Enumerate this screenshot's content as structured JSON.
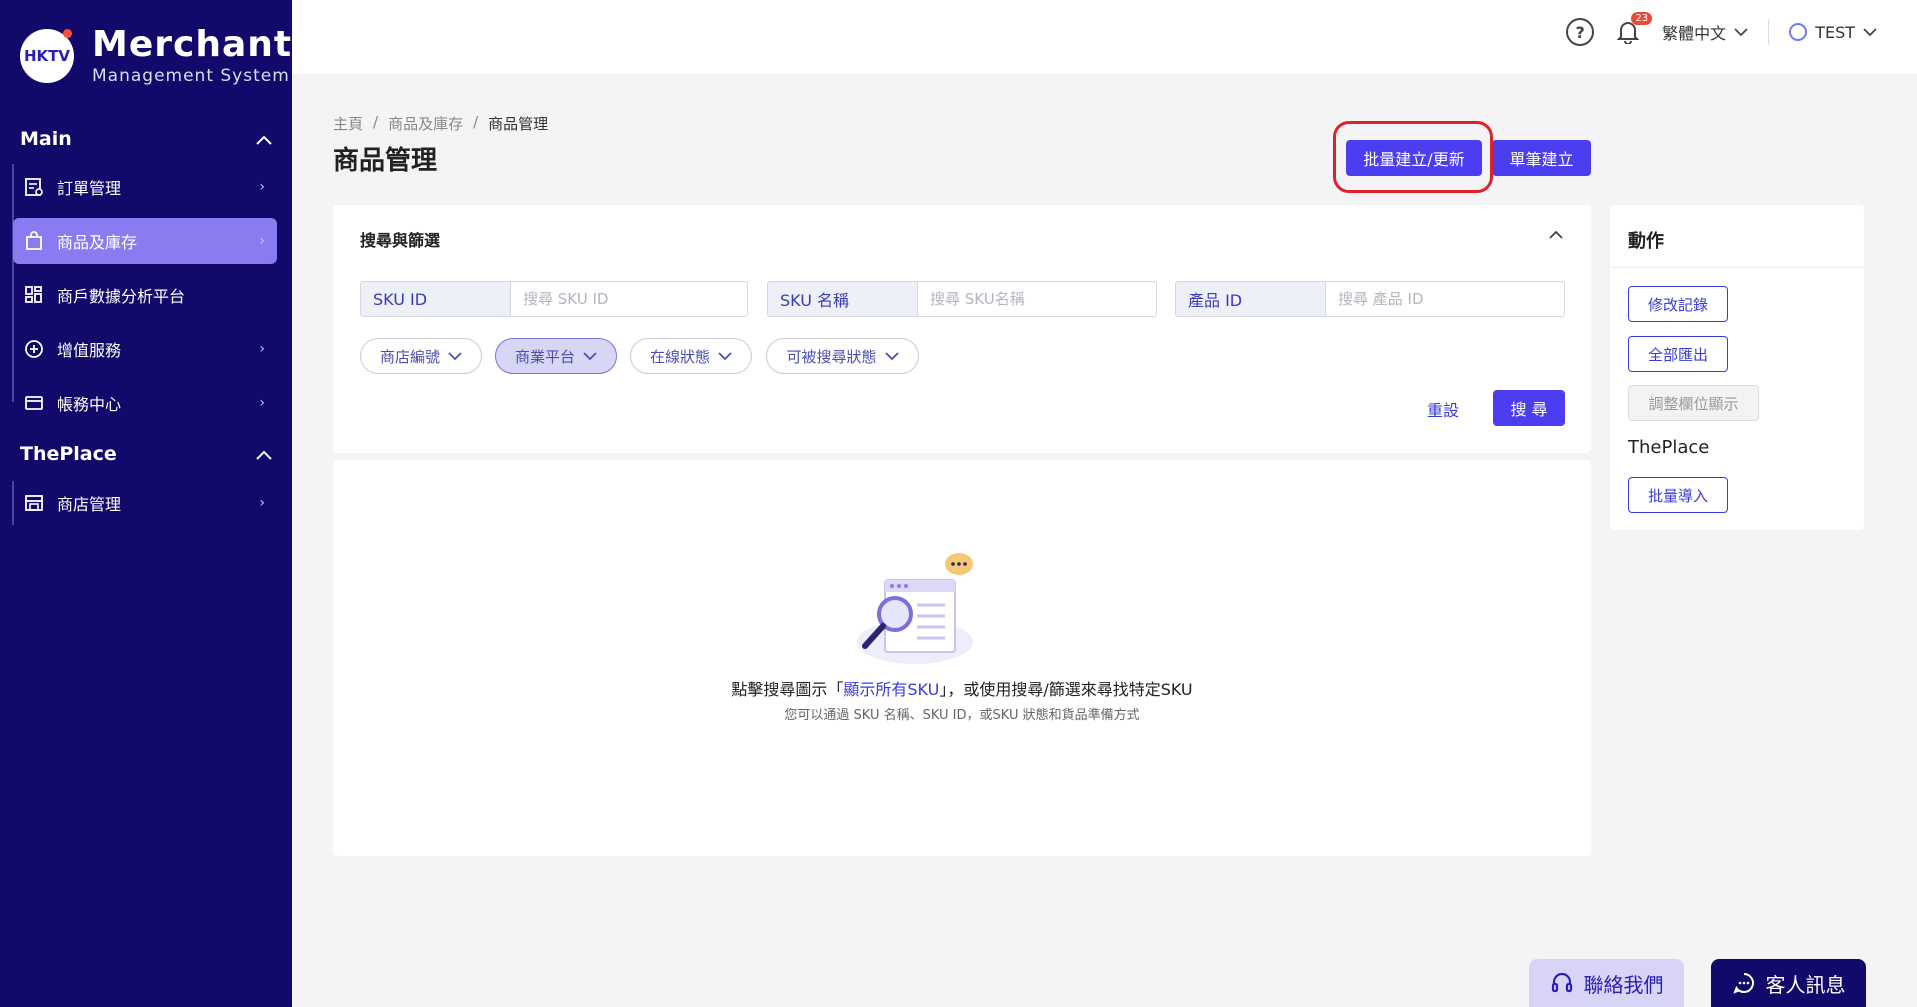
{
  "brand": {
    "badge": "HKTV",
    "title": "Merchant",
    "subtitle": "Management System"
  },
  "sidebar": {
    "main_section": "Main",
    "main_items": [
      {
        "label": "訂單管理",
        "icon": "order-list-icon"
      },
      {
        "label": "商品及庫存",
        "icon": "shopping-bag-icon",
        "active": true
      },
      {
        "label": "商戶數據分析平台",
        "icon": "dashboard-grid-icon"
      },
      {
        "label": "增值服務",
        "icon": "plus-circle-icon"
      },
      {
        "label": "帳務中心",
        "icon": "credit-card-icon"
      }
    ],
    "theplace_section": "ThePlace",
    "theplace_items": [
      {
        "label": "商店管理",
        "icon": "store-icon"
      }
    ]
  },
  "topbar": {
    "notification_count": "23",
    "language": "繁體中文",
    "user": "TEST"
  },
  "breadcrumb": [
    "主頁",
    "商品及庫存",
    "商品管理"
  ],
  "page_title": "商品管理",
  "header_buttons": {
    "bulk": "批量建立/更新",
    "single": "單筆建立"
  },
  "filter": {
    "title": "搜尋與篩選",
    "fields": [
      {
        "label": "SKU ID",
        "placeholder": "搜尋 SKU ID"
      },
      {
        "label": "SKU 名稱",
        "placeholder": "搜尋 SKU名稱"
      },
      {
        "label": "產品 ID",
        "placeholder": "搜尋 產品 ID"
      }
    ],
    "chips": [
      "商店編號",
      "商業平台",
      "在線狀態",
      "可被搜尋狀態"
    ],
    "reset": "重設",
    "search": "搜 尋"
  },
  "empty": {
    "line_prefix": "點擊搜尋圖示「",
    "line_link": "顯示所有SKU",
    "line_suffix": "」，或使用搜尋/篩選來尋找特定SKU",
    "sub": "您可以通過 SKU 名稱、SKU ID，或SKU 狀態和貨品準備方式"
  },
  "actions": {
    "title": "動作",
    "edit_log": "修改記錄",
    "export_all": "全部匯出",
    "adjust_columns": "調整欄位顯示",
    "theplace": "ThePlace",
    "bulk_import": "批量導入"
  },
  "floating": {
    "contact": "聯絡我們",
    "chat": "客人訊息"
  }
}
